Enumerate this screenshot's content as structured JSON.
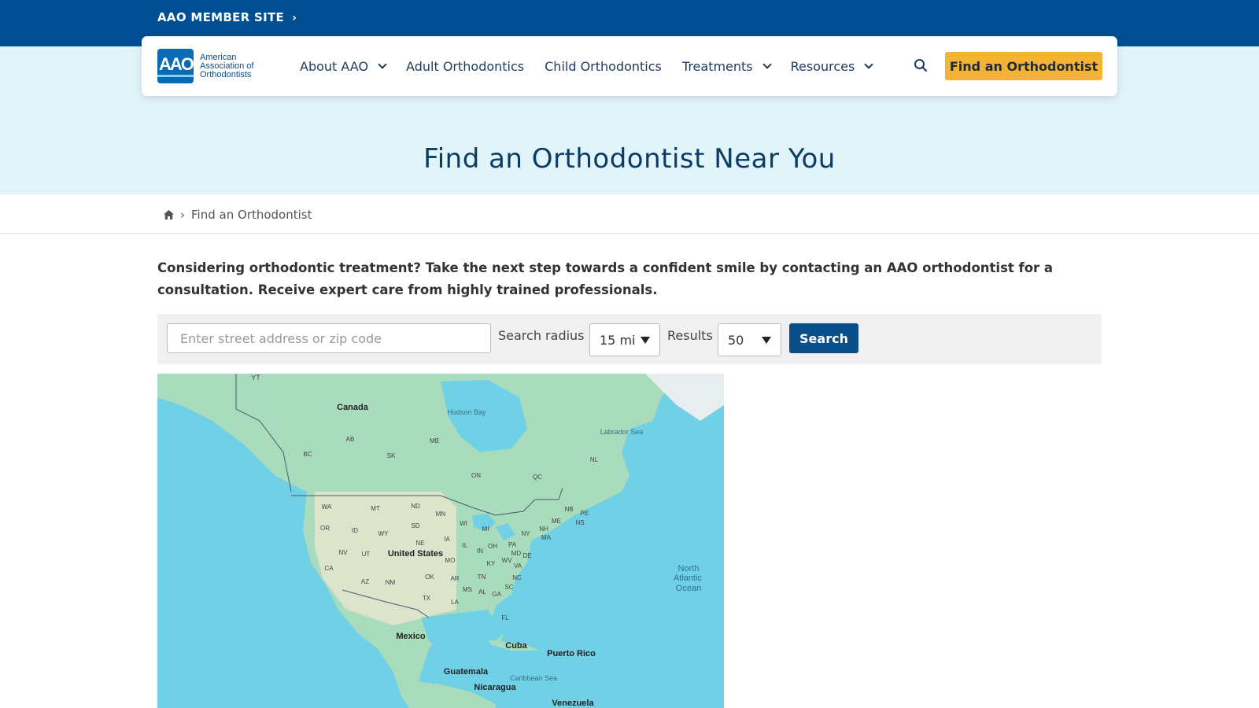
{
  "topbar": {
    "member_site_label": "AAO MEMBER SITE"
  },
  "logo": {
    "mark_text": "AAO",
    "line1": "American",
    "line2": "Association of",
    "line3": "Orthodontists"
  },
  "nav": {
    "items": [
      {
        "label": "About AAO",
        "has_dropdown": true
      },
      {
        "label": "Adult Orthodontics",
        "has_dropdown": false
      },
      {
        "label": "Child Orthodontics",
        "has_dropdown": false
      },
      {
        "label": "Treatments",
        "has_dropdown": true
      },
      {
        "label": "Resources",
        "has_dropdown": true
      }
    ],
    "cta_label": "Find an Orthodontist"
  },
  "hero": {
    "title": "Find an Orthodontist Near You"
  },
  "breadcrumb": {
    "current": "Find an Orthodontist"
  },
  "intro": "Considering orthodontic treatment? Take the next step towards a confident smile by contacting an AAO orthodontist for a consultation. Receive expert care from highly trained professionals.",
  "search": {
    "address_placeholder": "Enter street address or zip code",
    "radius_label": "Search radius",
    "radius_value": "15 mi",
    "results_label": "Results",
    "results_value": "50",
    "button_label": "Search"
  },
  "map": {
    "labels": {
      "yt": "YT",
      "canada": "Canada",
      "hudson_bay": "Hudson Bay",
      "labrador_sea": "Labrador Sea",
      "ab": "AB",
      "mb": "MB",
      "bc": "BC",
      "sk": "SK",
      "nl": "NL",
      "on": "ON",
      "qc": "QC",
      "wa": "WA",
      "mt": "MT",
      "nd": "ND",
      "mn": "MN",
      "nb": "NB",
      "pe": "PE",
      "ns": "NS",
      "me": "ME",
      "or": "OR",
      "id": "ID",
      "wy": "WY",
      "sd": "SD",
      "wi": "WI",
      "mi": "MI",
      "nh": "NH",
      "ny": "NY",
      "ma": "MA",
      "ne": "NE",
      "ia": "IA",
      "il": "IL",
      "oh": "OH",
      "pa": "PA",
      "md": "MD",
      "de": "DE",
      "nv": "NV",
      "ut": "UT",
      "united_states": "United States",
      "in": "IN",
      "mo": "MO",
      "ky": "KY",
      "wv": "WV",
      "va": "VA",
      "ca": "CA",
      "az": "AZ",
      "nm": "NM",
      "ok": "OK",
      "ar": "AR",
      "tn": "TN",
      "nc": "NC",
      "ms": "MS",
      "al": "AL",
      "sc": "SC",
      "ga": "GA",
      "tx": "TX",
      "la": "LA",
      "fl": "FL",
      "north": "North",
      "atlantic": "Atlantic",
      "ocean": "Ocean",
      "mexico": "Mexico",
      "cuba": "Cuba",
      "puerto_rico": "Puerto Rico",
      "guatemala": "Guatemala",
      "caribbean_sea": "Caribbean Sea",
      "nicaragua": "Nicaragua",
      "venezuela": "Venezuela"
    }
  },
  "colors": {
    "topbar": "#004f93",
    "hero_bg": "#e1f4fa",
    "cta": "#f5b335",
    "button": "#0b4f8a",
    "ocean": "#6fd0e6",
    "land": "#a9dcbc"
  }
}
